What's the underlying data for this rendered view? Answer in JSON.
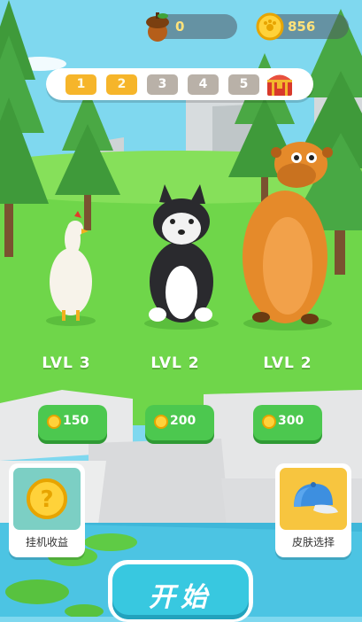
{
  "currency": {
    "acorns": "0",
    "coins": "856"
  },
  "levels": [
    "1",
    "2",
    "3",
    "4",
    "5"
  ],
  "levels_unlocked": 2,
  "characters": [
    {
      "name": "chicken",
      "level_label": "LVL 3",
      "price": "150"
    },
    {
      "name": "husky",
      "level_label": "LVL 2",
      "price": "200"
    },
    {
      "name": "capybara",
      "level_label": "LVL 2",
      "price": "300"
    }
  ],
  "side_buttons": {
    "idle_income": "挂机收益",
    "skin_select": "皮肤选择"
  },
  "start_button": "开始"
}
